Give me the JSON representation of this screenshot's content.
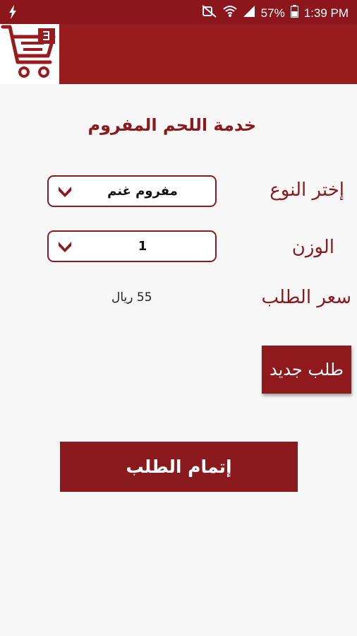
{
  "status_bar": {
    "battery": "57%",
    "time": "1:39 PM",
    "icons": [
      "flash-icon",
      "mute-icon",
      "wifi-icon",
      "signal-icon",
      "battery-icon"
    ]
  },
  "app_bar": {
    "icon": "cart-icon",
    "color": "#981b1e"
  },
  "page": {
    "title": "خدمة اللحم المفروم"
  },
  "form": {
    "type_label": "إختر النوع",
    "type_selected": "مفروم غنم",
    "weight_label": "الوزن",
    "weight_selected": "1",
    "price_label": "سعر الطلب",
    "price_value": "55 ريال"
  },
  "buttons": {
    "new_order": "طلب جديد",
    "complete_order": "إتمام الطلب"
  },
  "colors": {
    "primary": "#8b1a1f",
    "background": "#f7f7f7"
  }
}
